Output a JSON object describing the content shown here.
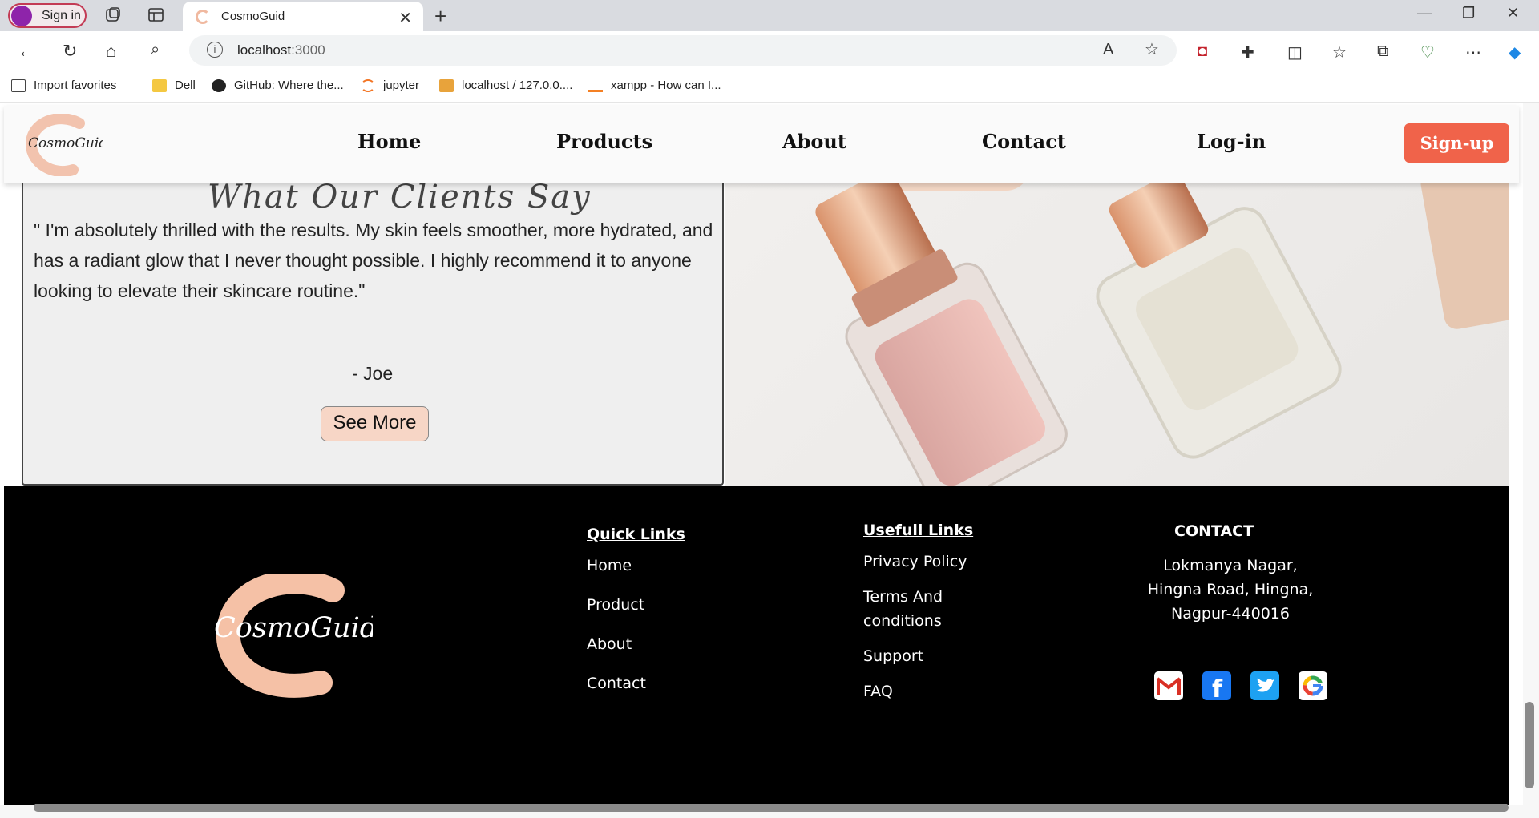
{
  "browser": {
    "profile_label": "Sign in",
    "tab_title": "CosmoGuid",
    "url_host": "localhost",
    "url_port": ":3000",
    "bookmarks": [
      {
        "label": "Import favorites"
      },
      {
        "label": "Dell"
      },
      {
        "label": "GitHub: Where the..."
      },
      {
        "label": "jupyter"
      },
      {
        "label": "localhost / 127.0.0...."
      },
      {
        "label": "xampp - How can I..."
      }
    ]
  },
  "site": {
    "logo_text": "CosmoGuid",
    "nav": {
      "home": "Home",
      "products": "Products",
      "about": "About",
      "contact": "Contact",
      "login": "Log-in",
      "signup": "Sign-up"
    },
    "testimonial": {
      "heading": "What Our Clients Say",
      "quote": "\" I'm absolutely thrilled with the results. My skin feels smoother, more hydrated, and has a radiant glow that I never thought possible. I highly recommend it to anyone looking to elevate their skincare routine.\"",
      "author": "- Joe",
      "see_more": "See More"
    },
    "footer": {
      "quick_links_title": "Quick Links",
      "quick_links": [
        "Home",
        "Product",
        "About",
        "Contact"
      ],
      "useful_links_title": "Usefull Links",
      "useful_links": [
        "Privacy Policy",
        "Terms And conditions",
        "Support",
        "FAQ"
      ],
      "contact_title": "CONTACT",
      "address": "Lokmanya Nagar, Hingna Road, Hingna, Nagpur-440016",
      "social_icons": [
        "gmail-icon",
        "facebook-icon",
        "twitter-icon",
        "google-icon"
      ]
    }
  },
  "colors": {
    "accent": "#f0634a",
    "peach": "#f7d6c6",
    "footer_bg": "#000000"
  }
}
